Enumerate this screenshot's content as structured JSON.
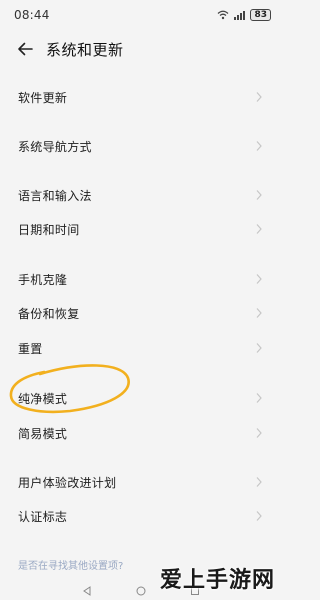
{
  "status_bar": {
    "time": "08:44",
    "battery": "83",
    "wifi_icon": "wifi-icon",
    "signal_icon": "signal-icon"
  },
  "header": {
    "back_icon": "back-arrow-icon",
    "title": "系统和更新"
  },
  "menu": {
    "items": [
      {
        "label": "软件更新"
      },
      {
        "label": "系统导航方式"
      },
      {
        "label": "语言和输入法"
      },
      {
        "label": "日期和时间"
      },
      {
        "label": "手机克隆"
      },
      {
        "label": "备份和恢复"
      },
      {
        "label": "重置"
      },
      {
        "label": "纯净模式"
      },
      {
        "label": "简易模式"
      },
      {
        "label": "用户体验改进计划"
      },
      {
        "label": "认证标志"
      }
    ]
  },
  "hint": "是否在寻找其他设置项?",
  "watermark": "爱上手游网",
  "colors": {
    "background": "#f4f4f4",
    "hint": "#9aa9c4",
    "annotation": "#f2b01e"
  }
}
